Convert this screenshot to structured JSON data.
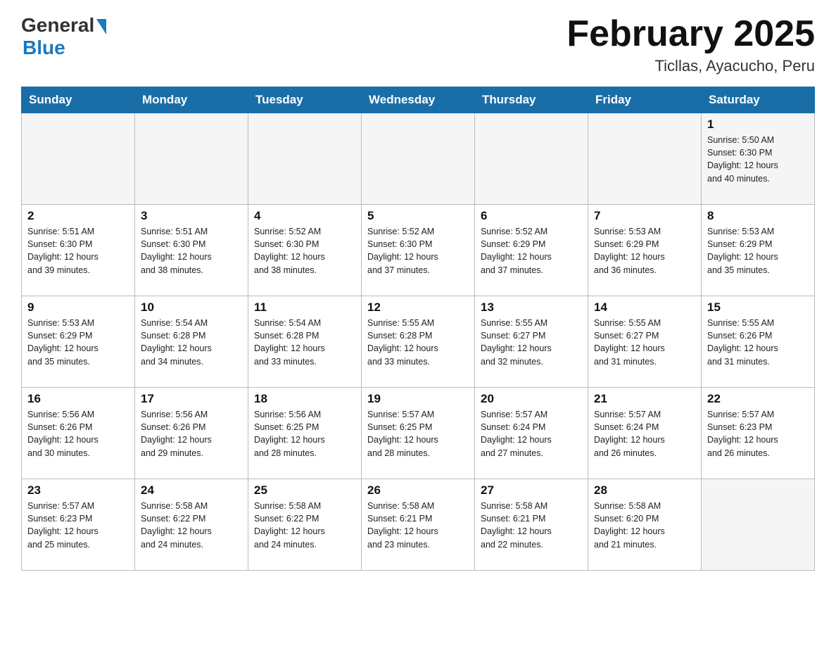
{
  "header": {
    "logo": {
      "general": "General",
      "blue": "Blue"
    },
    "title": "February 2025",
    "location": "Ticllas, Ayacucho, Peru"
  },
  "days_of_week": [
    "Sunday",
    "Monday",
    "Tuesday",
    "Wednesday",
    "Thursday",
    "Friday",
    "Saturday"
  ],
  "weeks": [
    [
      {
        "day": "",
        "info": ""
      },
      {
        "day": "",
        "info": ""
      },
      {
        "day": "",
        "info": ""
      },
      {
        "day": "",
        "info": ""
      },
      {
        "day": "",
        "info": ""
      },
      {
        "day": "",
        "info": ""
      },
      {
        "day": "1",
        "info": "Sunrise: 5:50 AM\nSunset: 6:30 PM\nDaylight: 12 hours\nand 40 minutes."
      }
    ],
    [
      {
        "day": "2",
        "info": "Sunrise: 5:51 AM\nSunset: 6:30 PM\nDaylight: 12 hours\nand 39 minutes."
      },
      {
        "day": "3",
        "info": "Sunrise: 5:51 AM\nSunset: 6:30 PM\nDaylight: 12 hours\nand 38 minutes."
      },
      {
        "day": "4",
        "info": "Sunrise: 5:52 AM\nSunset: 6:30 PM\nDaylight: 12 hours\nand 38 minutes."
      },
      {
        "day": "5",
        "info": "Sunrise: 5:52 AM\nSunset: 6:30 PM\nDaylight: 12 hours\nand 37 minutes."
      },
      {
        "day": "6",
        "info": "Sunrise: 5:52 AM\nSunset: 6:29 PM\nDaylight: 12 hours\nand 37 minutes."
      },
      {
        "day": "7",
        "info": "Sunrise: 5:53 AM\nSunset: 6:29 PM\nDaylight: 12 hours\nand 36 minutes."
      },
      {
        "day": "8",
        "info": "Sunrise: 5:53 AM\nSunset: 6:29 PM\nDaylight: 12 hours\nand 35 minutes."
      }
    ],
    [
      {
        "day": "9",
        "info": "Sunrise: 5:53 AM\nSunset: 6:29 PM\nDaylight: 12 hours\nand 35 minutes."
      },
      {
        "day": "10",
        "info": "Sunrise: 5:54 AM\nSunset: 6:28 PM\nDaylight: 12 hours\nand 34 minutes."
      },
      {
        "day": "11",
        "info": "Sunrise: 5:54 AM\nSunset: 6:28 PM\nDaylight: 12 hours\nand 33 minutes."
      },
      {
        "day": "12",
        "info": "Sunrise: 5:55 AM\nSunset: 6:28 PM\nDaylight: 12 hours\nand 33 minutes."
      },
      {
        "day": "13",
        "info": "Sunrise: 5:55 AM\nSunset: 6:27 PM\nDaylight: 12 hours\nand 32 minutes."
      },
      {
        "day": "14",
        "info": "Sunrise: 5:55 AM\nSunset: 6:27 PM\nDaylight: 12 hours\nand 31 minutes."
      },
      {
        "day": "15",
        "info": "Sunrise: 5:55 AM\nSunset: 6:26 PM\nDaylight: 12 hours\nand 31 minutes."
      }
    ],
    [
      {
        "day": "16",
        "info": "Sunrise: 5:56 AM\nSunset: 6:26 PM\nDaylight: 12 hours\nand 30 minutes."
      },
      {
        "day": "17",
        "info": "Sunrise: 5:56 AM\nSunset: 6:26 PM\nDaylight: 12 hours\nand 29 minutes."
      },
      {
        "day": "18",
        "info": "Sunrise: 5:56 AM\nSunset: 6:25 PM\nDaylight: 12 hours\nand 28 minutes."
      },
      {
        "day": "19",
        "info": "Sunrise: 5:57 AM\nSunset: 6:25 PM\nDaylight: 12 hours\nand 28 minutes."
      },
      {
        "day": "20",
        "info": "Sunrise: 5:57 AM\nSunset: 6:24 PM\nDaylight: 12 hours\nand 27 minutes."
      },
      {
        "day": "21",
        "info": "Sunrise: 5:57 AM\nSunset: 6:24 PM\nDaylight: 12 hours\nand 26 minutes."
      },
      {
        "day": "22",
        "info": "Sunrise: 5:57 AM\nSunset: 6:23 PM\nDaylight: 12 hours\nand 26 minutes."
      }
    ],
    [
      {
        "day": "23",
        "info": "Sunrise: 5:57 AM\nSunset: 6:23 PM\nDaylight: 12 hours\nand 25 minutes."
      },
      {
        "day": "24",
        "info": "Sunrise: 5:58 AM\nSunset: 6:22 PM\nDaylight: 12 hours\nand 24 minutes."
      },
      {
        "day": "25",
        "info": "Sunrise: 5:58 AM\nSunset: 6:22 PM\nDaylight: 12 hours\nand 24 minutes."
      },
      {
        "day": "26",
        "info": "Sunrise: 5:58 AM\nSunset: 6:21 PM\nDaylight: 12 hours\nand 23 minutes."
      },
      {
        "day": "27",
        "info": "Sunrise: 5:58 AM\nSunset: 6:21 PM\nDaylight: 12 hours\nand 22 minutes."
      },
      {
        "day": "28",
        "info": "Sunrise: 5:58 AM\nSunset: 6:20 PM\nDaylight: 12 hours\nand 21 minutes."
      },
      {
        "day": "",
        "info": ""
      }
    ]
  ]
}
